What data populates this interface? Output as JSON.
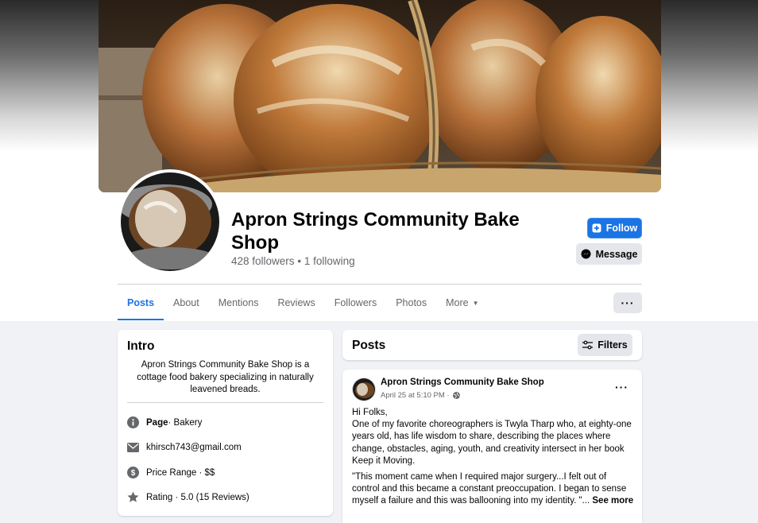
{
  "page": {
    "title": "Apron Strings Community Bake Shop",
    "followers": "428 followers",
    "separator": "•",
    "following": "1 following"
  },
  "actions": {
    "follow_label": "Follow",
    "message_label": "Message",
    "more_label": "···"
  },
  "tabs": [
    {
      "label": "Posts",
      "active": true
    },
    {
      "label": "About"
    },
    {
      "label": "Mentions"
    },
    {
      "label": "Reviews"
    },
    {
      "label": "Followers"
    },
    {
      "label": "Photos"
    },
    {
      "label": "More"
    }
  ],
  "intro": {
    "heading": "Intro",
    "bio": "Apron Strings Community Bake Shop is a cottage food bakery specializing in naturally leavened breads.",
    "page_label": "Page",
    "page_category": " · Bakery",
    "email": "khirsch743@gmail.com",
    "price_range": "Price Range · $$",
    "rating": "Rating · 5.0 (15 Reviews)"
  },
  "posts_header": {
    "heading": "Posts",
    "filters_label": "Filters"
  },
  "post": {
    "author": "Apron Strings Community Bake Shop",
    "time": "April 25 at 5:10 PM ·",
    "menu": "···",
    "greeting": "Hi Folks,",
    "paragraph1": "One of my favorite choreographers is Twyla Tharp who, at eighty-one years old, has life wisdom to share, describing the places where change, obstacles, aging, youth, and creativity intersect in her book Keep it Moving.",
    "paragraph2": "\"This moment came when I required  major surgery...I felt out of control and this became a constant preoccupation. I began to sense myself a failure and this was ballooning into my identity. \"...",
    "see_more": "See more"
  },
  "colors": {
    "accent": "#1b74e4",
    "background": "#f0f2f5",
    "secondary_text": "#65676b"
  }
}
